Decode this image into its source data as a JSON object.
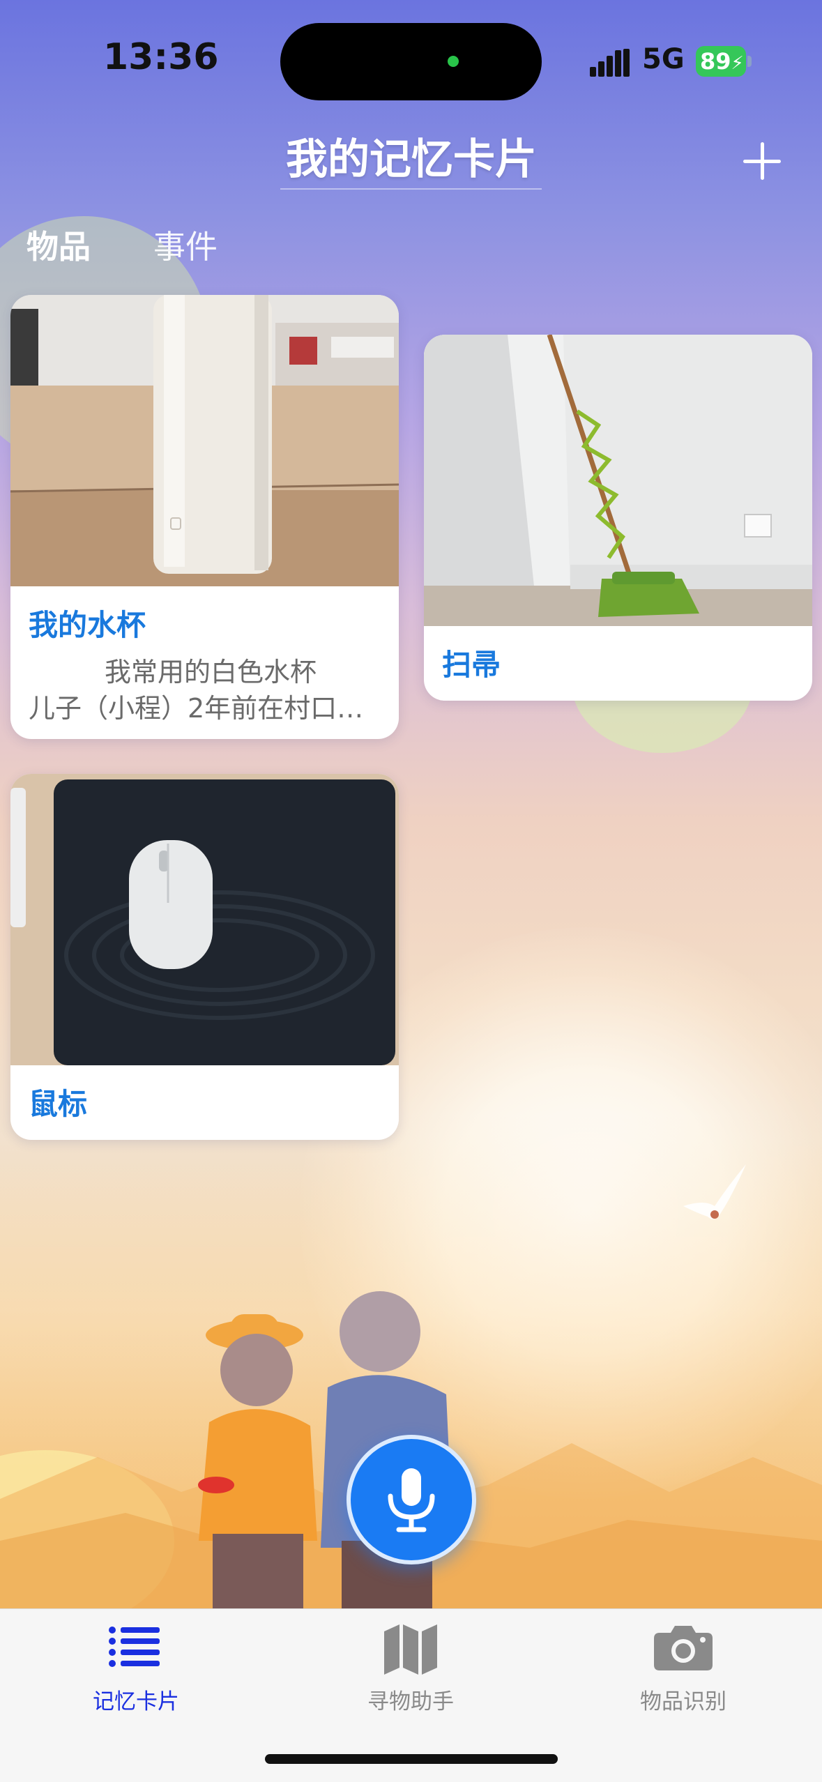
{
  "status_bar": {
    "time": "13:36",
    "network": "5G",
    "battery": "89"
  },
  "header": {
    "title": "我的记忆卡片",
    "add_icon": "plus-icon"
  },
  "tabs": [
    {
      "label": "物品",
      "active": true
    },
    {
      "label": "事件",
      "active": false
    }
  ],
  "cards": [
    {
      "title": "我的水杯",
      "desc_line1": "我常用的白色水杯",
      "desc_line2": "儿子（小程）2年前在村口…",
      "photo": "white-water-bottle"
    },
    {
      "title": "扫帚",
      "photo": "broom-against-wall"
    },
    {
      "title": "鼠标",
      "photo": "white-mouse-on-pad"
    }
  ],
  "mic_button": {
    "icon": "microphone-icon"
  },
  "bottom_nav": [
    {
      "label": "记忆卡片",
      "icon": "list-icon",
      "active": true
    },
    {
      "label": "寻物助手",
      "icon": "map-icon",
      "active": false
    },
    {
      "label": "物品识别",
      "icon": "camera-icon",
      "active": false
    }
  ],
  "colors": {
    "accent": "#1979dd",
    "tab_active": "#1a2fe0",
    "tab_inactive": "#8a8a8a",
    "mic": "#1a7bf3"
  }
}
